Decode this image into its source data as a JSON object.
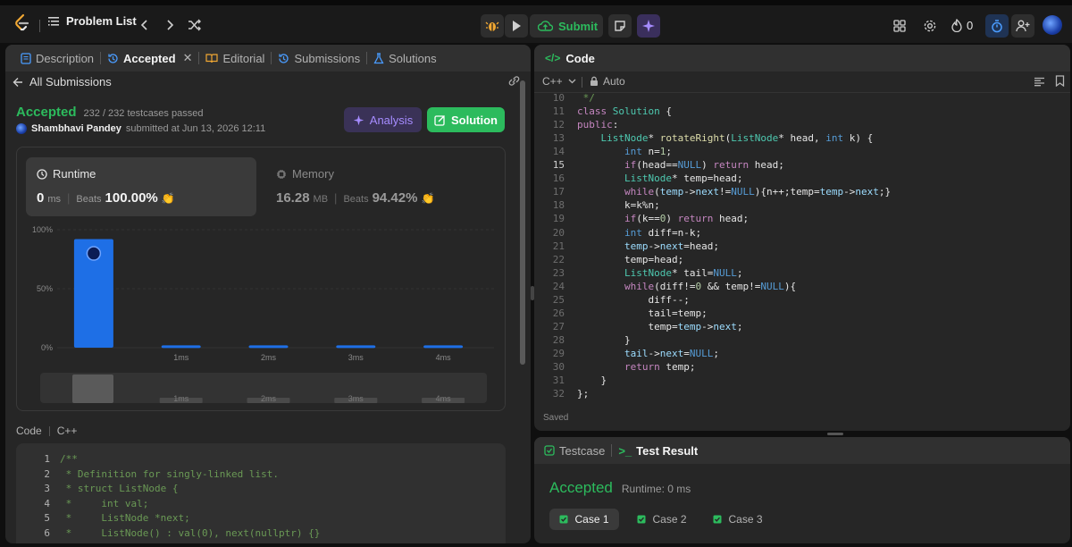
{
  "topbar": {
    "problem_list": "Problem List",
    "submit": "Submit",
    "streak": "0"
  },
  "left_tabs": {
    "description": "Description",
    "accepted": "Accepted",
    "editorial": "Editorial",
    "submissions": "Submissions",
    "solutions": "Solutions"
  },
  "all_submissions": "All Submissions",
  "result": {
    "status": "Accepted",
    "testcases": "232 / 232 testcases passed",
    "user": "Shambhavi Pandey",
    "submitted": "submitted at Jun 13, 2026 12:11",
    "analysis": "Analysis",
    "solution": "Solution"
  },
  "runtime": {
    "label": "Runtime",
    "value": "0",
    "unit": "ms",
    "beats_label": "Beats",
    "beats": "100.00%"
  },
  "memory": {
    "label": "Memory",
    "value": "16.28",
    "unit": "MB",
    "beats_label": "Beats",
    "beats": "94.42%"
  },
  "chart_data": {
    "type": "bar",
    "categories": [
      "0ms",
      "1ms",
      "2ms",
      "3ms",
      "4ms"
    ],
    "values": [
      92,
      2,
      2,
      2,
      2
    ],
    "yticks": [
      "100%",
      "50%",
      "0%"
    ],
    "xlabels": [
      "1ms",
      "2ms",
      "3ms",
      "4ms"
    ],
    "ylim": [
      0,
      100
    ]
  },
  "code_section": {
    "label": "Code",
    "lang": "C++",
    "lines": [
      {
        "n": "1",
        "t": "/**"
      },
      {
        "n": "2",
        "t": " * Definition for singly-linked list."
      },
      {
        "n": "3",
        "t": " * struct ListNode {"
      },
      {
        "n": "4",
        "t": " *     int val;"
      },
      {
        "n": "5",
        "t": " *     ListNode *next;"
      },
      {
        "n": "6",
        "t": " *     ListNode() : val(0), next(nullptr) {}"
      }
    ]
  },
  "editor": {
    "title": "Code",
    "lang": "C++",
    "mode": "Auto",
    "saved": "Saved",
    "lines": [
      {
        "n": "10",
        "t": " */"
      },
      {
        "n": "11",
        "t": "class Solution {"
      },
      {
        "n": "12",
        "t": "public:"
      },
      {
        "n": "13",
        "t": "    ListNode* rotateRight(ListNode* head, int k) {"
      },
      {
        "n": "14",
        "t": "        int n=1;"
      },
      {
        "n": "15",
        "t": "        if(head==NULL) return head;"
      },
      {
        "n": "16",
        "t": "        ListNode* temp=head;"
      },
      {
        "n": "17",
        "t": "        while(temp->next!=NULL){n++;temp=temp->next;}"
      },
      {
        "n": "18",
        "t": "        k=k%n;"
      },
      {
        "n": "19",
        "t": "        if(k==0) return head;"
      },
      {
        "n": "20",
        "t": "        int diff=n-k;"
      },
      {
        "n": "21",
        "t": "        temp->next=head;"
      },
      {
        "n": "22",
        "t": "        temp=head;"
      },
      {
        "n": "23",
        "t": "        ListNode* tail=NULL;"
      },
      {
        "n": "24",
        "t": "        while(diff!=0 && temp!=NULL){"
      },
      {
        "n": "25",
        "t": "            diff--;"
      },
      {
        "n": "26",
        "t": "            tail=temp;"
      },
      {
        "n": "27",
        "t": "            temp=temp->next;"
      },
      {
        "n": "28",
        "t": "        }"
      },
      {
        "n": "29",
        "t": "        tail->next=NULL;"
      },
      {
        "n": "30",
        "t": "        return temp;"
      },
      {
        "n": "31",
        "t": "    }"
      },
      {
        "n": "32",
        "t": "};"
      }
    ]
  },
  "bottom": {
    "testcase_tab": "Testcase",
    "result_tab": "Test Result",
    "status": "Accepted",
    "runtime": "Runtime: 0 ms",
    "cases": [
      "Case 1",
      "Case 2",
      "Case 3"
    ]
  },
  "colors": {
    "accent_green": "#2cbb5d",
    "bar_blue": "#1e6fe6",
    "analysis_purple": "#a68cff"
  }
}
